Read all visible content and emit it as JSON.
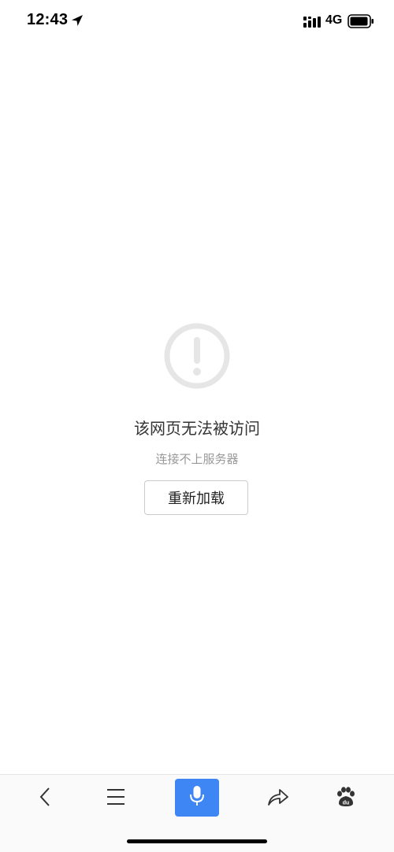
{
  "status_bar": {
    "time": "12:43",
    "network": "4G",
    "icons": [
      "location-arrow-icon",
      "signal-icon",
      "battery-icon"
    ]
  },
  "error": {
    "icon": "exclamation-circle-icon",
    "title": "该网页无法被访问",
    "subtitle": "连接不上服务器",
    "reload_label": "重新加载"
  },
  "toolbar": {
    "items": [
      "back-icon",
      "menu-icon",
      "microphone-icon",
      "share-icon",
      "baidu-paw-icon"
    ],
    "accent": "#3f86f5"
  }
}
